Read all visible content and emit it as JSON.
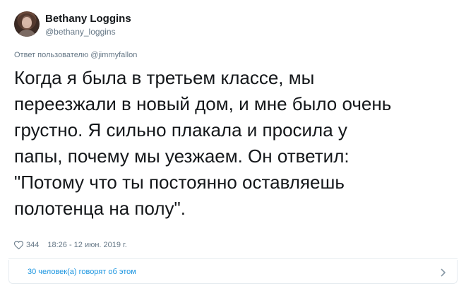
{
  "tweet": {
    "author_name": "Bethany Loggins",
    "author_handle": "@bethany_loggins",
    "reply_prefix": "Ответ пользователю",
    "reply_mention": "@jimmyfallon",
    "text": "Когда я была в третьем классе, мы\nпереезжали в новый дом, и мне было очень\nгрустно. Я сильно плакала и просила у\nпапы, почему мы уезжаем. Он ответил:\n\"Потому что ты постоянно оставляешь\nполотенца на полу\".",
    "likes": "344",
    "timestamp": "18:26 - 12 июн. 2019 г."
  },
  "footer": {
    "conversation_label": "30 человек(а) говорят об этом"
  },
  "icons": {
    "like": "heart-icon",
    "more": "chevron-right-icon"
  },
  "colors": {
    "link": "#1b95e0",
    "secondary_text": "#657786",
    "primary_text": "#14171a"
  }
}
